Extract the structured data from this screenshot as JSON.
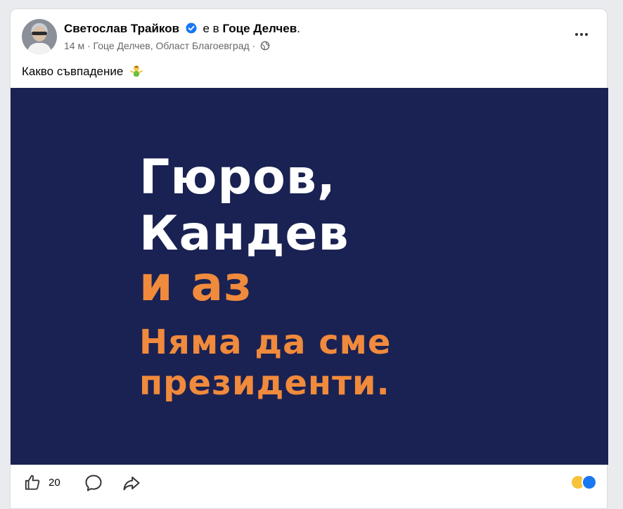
{
  "post": {
    "author": "Светослав Трайков",
    "is_in": "е в",
    "place": "Гоце Делчев",
    "time": "14 м",
    "location": "Гоце Делчев, Област Благоевград",
    "text": "Какво съвпадение",
    "like_count": "20"
  },
  "image": {
    "line1": "Гюров,",
    "line2": "Кандев",
    "line3": "и аз",
    "line4": "Няма да сме",
    "line5": "президенти."
  },
  "colors": {
    "image_background": "#1a2253",
    "headline_white": "#ffffff",
    "headline_orange": "#f08a3c",
    "verified_blue": "#1877f2"
  },
  "icons": {
    "verified": "verified-badge-icon",
    "globe": "globe-icon",
    "more": "more-options-icon",
    "like": "like-icon",
    "comment": "comment-icon",
    "share": "share-icon"
  }
}
